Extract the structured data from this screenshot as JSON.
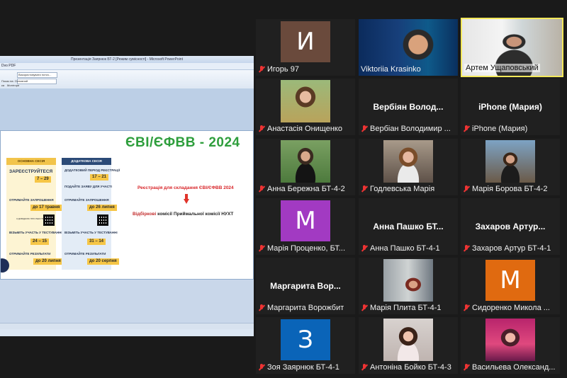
{
  "share": {
    "title_bar": "Презентація Заярнюк БТ-2 [Режим сумісності] - Microsoft PowerPoint",
    "ribbon_tab": "Dvo PDF",
    "dropdown_value": "Використовувати поточ...",
    "ribbon_label_a": "Показ на: Основний",
    "ribbon_label_b": "Монітори",
    "ribbon_left": "ка",
    "slide": {
      "title": "ЄВІ/ЄФВВ - 2024",
      "main_session": {
        "header": "ОСНОВНА СЕСІЯ",
        "items": [
          "ЗАРЕЄСТРУЙТЕСЯ",
          "ОТРИМАЙТЕ ЗАПРОШЕННЯ",
          "",
          "ВІЗЬМІТЬ УЧАСТЬ У ТЕСТУВАННІ",
          "ОТРИМАЙТЕ РЕЗУЛЬТАТИ"
        ],
        "dates": [
          "7 – 29",
          "до 17 травня",
          "24 – 15",
          "до 20 липня"
        ],
        "qr_label": "З ДОВІДКОЮ ПРО РЕЄСТРАЦІЮ"
      },
      "extra_session": {
        "header": "ДОДАТКОВА СЕСІЯ",
        "items": [
          "ДОДАТКОВИЙ ПЕРІОД РЕЄСТРАЦІЇ",
          "ПОДАЙТЕ ЗАЯВУ ДЛЯ УЧАСТІ",
          "ОТРИМАЙТЕ ЗАПРОШЕННЯ",
          "ВІЗЬМІТЬ УЧАСТЬ У ТЕСТУВАННІ",
          "ОТРИМАЙТЕ РЕЗУЛЬТАТИ"
        ],
        "dates": [
          "17 – 21",
          "до 26 липня",
          "31 – 14",
          "до 20 серпня"
        ]
      },
      "registration_text": "Реєстрація для складання",
      "registration_bold": "ЄВІ/ЄФВВ 2024",
      "komisii_red": "Відбіркові",
      "komisii_rest": "комісії Приймальної комісії НУХТ"
    }
  },
  "participants": [
    {
      "name": "Игорь 97",
      "avatar_letter": "И",
      "avatar_color": "#6a4a3c",
      "muted": true
    },
    {
      "name": "Viktoriia Krasinko",
      "muted": true
    },
    {
      "name": "Артем Ущаповський",
      "muted": false,
      "active_speaker": true
    },
    {
      "name": "Анастасія Онищенко",
      "muted": true
    },
    {
      "name": "Вербіан Володимир ...",
      "center_name": "Вербіян Волод...",
      "muted": true
    },
    {
      "name": "iPhone (Мария)",
      "center_name": "iPhone (Мария)",
      "muted": true
    },
    {
      "name": "Анна Бережна БТ-4-2",
      "muted": true
    },
    {
      "name": "Годлевська Марія",
      "muted": true
    },
    {
      "name": "Марія Борова БТ-4-2",
      "muted": true
    },
    {
      "name": "Марія Проценко, БТ...",
      "avatar_letter": "M",
      "avatar_color": "#a23ac2",
      "muted": true
    },
    {
      "name": "Анна Пашко БТ-4-1",
      "center_name": "Анна Пашко БТ...",
      "muted": true
    },
    {
      "name": "Захаров Артур БТ-4-1",
      "center_name": "Захаров Артур...",
      "muted": true
    },
    {
      "name": "Маргарита Ворожбит",
      "center_name": "Маргарита Вор...",
      "muted": true
    },
    {
      "name": "Марія Плита БТ-4-1",
      "muted": true
    },
    {
      "name": "Сидоренко Микола ...",
      "avatar_letter": "M",
      "avatar_color": "#e06a10",
      "muted": true
    },
    {
      "name": "Зоя Заярнюк БТ-4-1",
      "avatar_letter": "З",
      "avatar_color": "#0a64b8",
      "muted": true
    },
    {
      "name": "Антоніна Бойко БТ-4-3",
      "muted": true
    },
    {
      "name": "Васильева Олександ...",
      "muted": true
    }
  ]
}
